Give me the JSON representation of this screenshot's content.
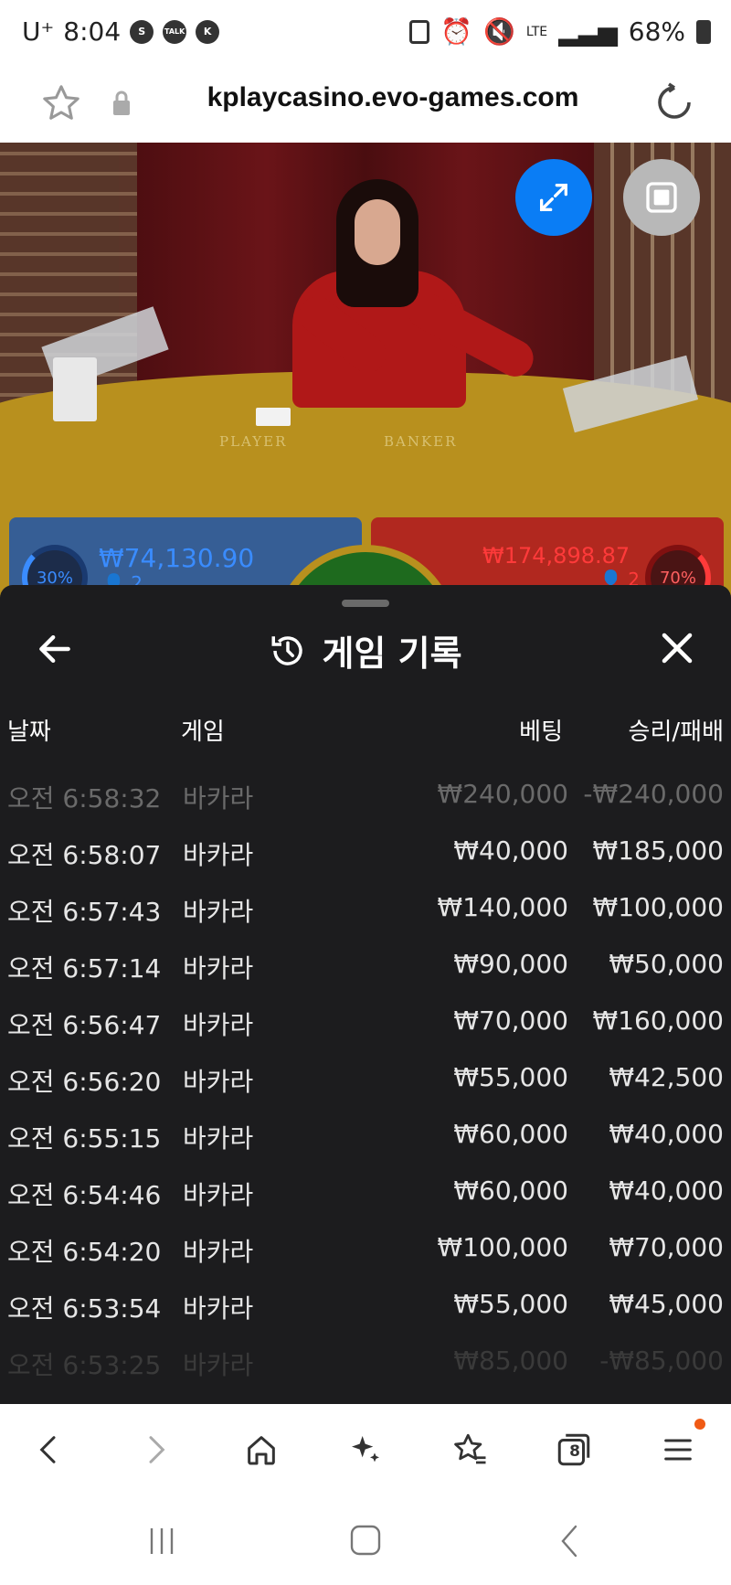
{
  "status_bar": {
    "carrier": "U⁺",
    "time": "8:04",
    "icons_left": [
      "s-icon",
      "talk-icon",
      "k-icon"
    ],
    "lte": "LTE",
    "battery": "68%"
  },
  "browser": {
    "url": "kplaycasino.evo-games.com"
  },
  "video": {
    "table_player_label": "PLAYER",
    "table_banker_label": "BANKER",
    "player_percent": "30%",
    "player_amount": "₩74,130.90",
    "player_count": "2",
    "banker_percent": "70%",
    "banker_amount": "₩174,898.87",
    "banker_count": "2"
  },
  "history": {
    "title": "게임 기록",
    "columns": {
      "date": "날짜",
      "game": "게임",
      "bet": "베팅",
      "win_loss": "승리/패배"
    },
    "rows": [
      {
        "date": "오전 6:58:32",
        "game": "바카라",
        "bet": "₩240,000",
        "win_loss": "-₩240,000"
      },
      {
        "date": "오전 6:58:07",
        "game": "바카라",
        "bet": "₩40,000",
        "win_loss": "₩185,000"
      },
      {
        "date": "오전 6:57:43",
        "game": "바카라",
        "bet": "₩140,000",
        "win_loss": "₩100,000"
      },
      {
        "date": "오전 6:57:14",
        "game": "바카라",
        "bet": "₩90,000",
        "win_loss": "₩50,000"
      },
      {
        "date": "오전 6:56:47",
        "game": "바카라",
        "bet": "₩70,000",
        "win_loss": "₩160,000"
      },
      {
        "date": "오전 6:56:20",
        "game": "바카라",
        "bet": "₩55,000",
        "win_loss": "₩42,500"
      },
      {
        "date": "오전 6:55:15",
        "game": "바카라",
        "bet": "₩60,000",
        "win_loss": "₩40,000"
      },
      {
        "date": "오전 6:54:46",
        "game": "바카라",
        "bet": "₩60,000",
        "win_loss": "₩40,000"
      },
      {
        "date": "오전 6:54:20",
        "game": "바카라",
        "bet": "₩100,000",
        "win_loss": "₩70,000"
      },
      {
        "date": "오전 6:53:54",
        "game": "바카라",
        "bet": "₩55,000",
        "win_loss": "₩45,000"
      },
      {
        "date": "오전 6:53:25",
        "game": "바카라",
        "bet": "₩85,000",
        "win_loss": "-₩85,000"
      }
    ]
  },
  "bottom_bar": {
    "tabs_count": "8"
  },
  "colors": {
    "accent_blue": "#0a7df5",
    "sheet_bg": "#1c1c1e",
    "player_blue": "#3a8cff",
    "banker_red": "#ff3a3a",
    "notification": "#f05a14"
  }
}
